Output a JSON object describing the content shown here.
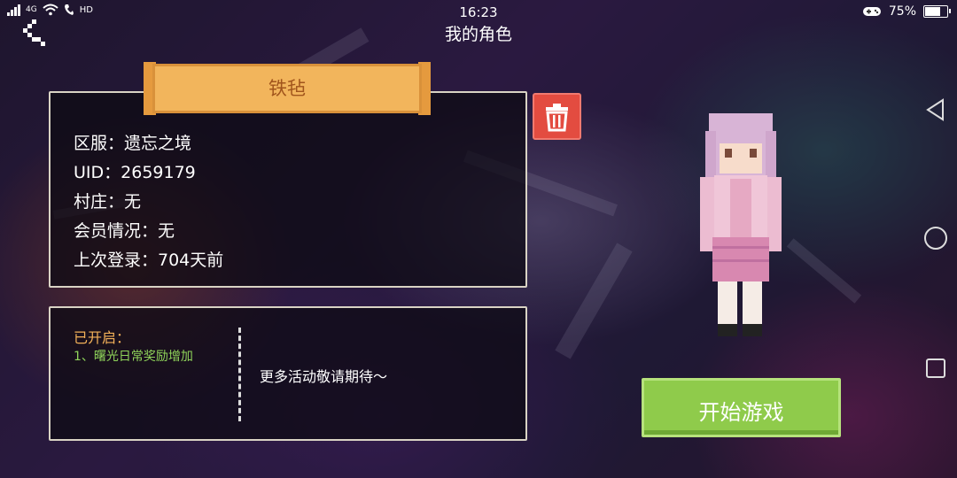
{
  "status_bar": {
    "network": "4G",
    "hd": "HD",
    "time": "16:23",
    "battery": "75%",
    "battery_level": 0.75
  },
  "header": {
    "title": "我的角色"
  },
  "character": {
    "name": "铁毡",
    "info": [
      "区服：遗忘之境",
      "UID：2659179",
      "村庄：无",
      "会员情况：无",
      "上次登录：704天前"
    ]
  },
  "activities": {
    "heading": "已开启：",
    "items": [
      "1、曙光日常奖励增加"
    ],
    "more": "更多活动敬请期待～"
  },
  "actions": {
    "start_label": "开始游戏"
  },
  "colors": {
    "banner": "#f2b55c",
    "delete_button": "#e34c40",
    "start_button": "#8fcb4b",
    "activity_heading": "#f3b159",
    "activity_item": "#8fd45a"
  },
  "icons": {
    "back": "back-icon",
    "delete": "trash-icon",
    "nav_back": "triangle-back-icon",
    "nav_home": "circle-home-icon",
    "nav_recent": "square-recent-icon"
  }
}
